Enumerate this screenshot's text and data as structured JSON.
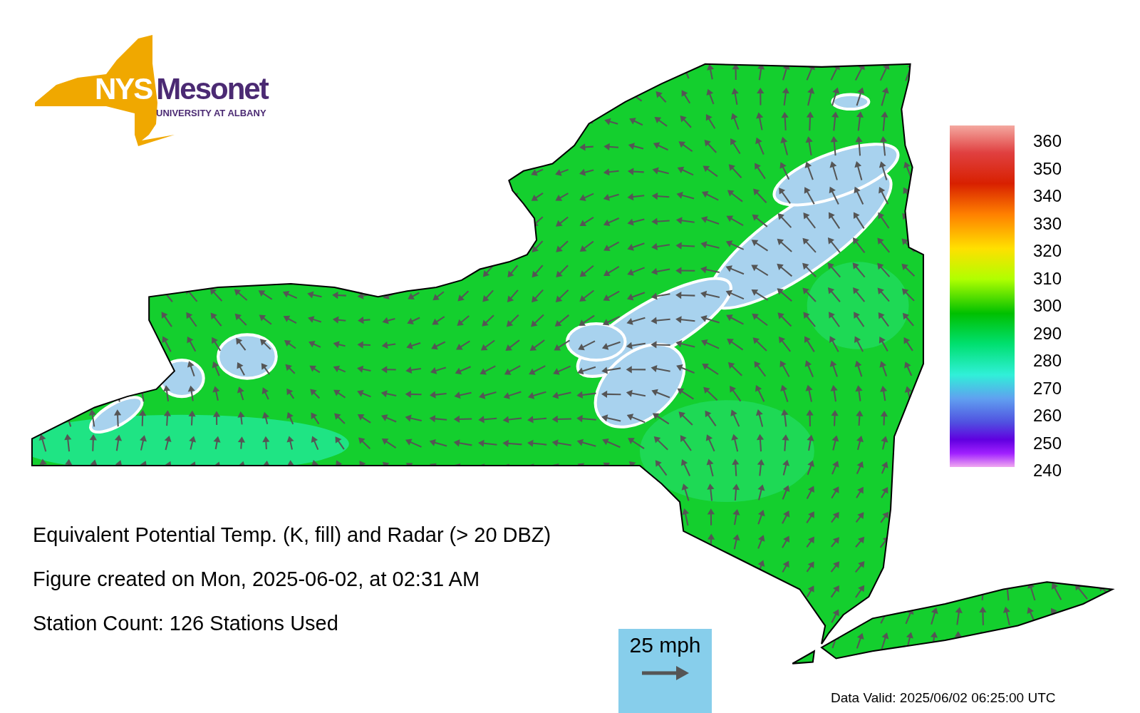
{
  "logo": {
    "short": "NYS",
    "name": "Mesonet",
    "subtitle": "UNIVERSITY AT ALBANY"
  },
  "colorbar": {
    "labels": [
      "360",
      "350",
      "340",
      "330",
      "320",
      "310",
      "300",
      "290",
      "280",
      "270",
      "260",
      "250",
      "240"
    ]
  },
  "captions": [
    "Equivalent Potential Temp. (K, fill) and Radar (> 20 DBZ)",
    "Figure created on Mon, 2025-06-02, at 02:31 AM",
    "Station Count: 126 Stations Used"
  ],
  "wind_scale": {
    "label": "25 mph"
  },
  "data_valid": "Data Valid: 2025/06/02 06:25:00 UTC"
}
